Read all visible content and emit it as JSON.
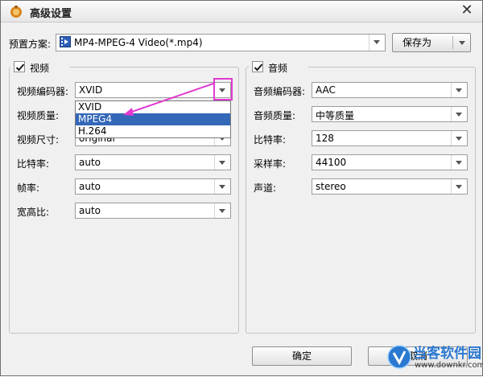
{
  "window": {
    "title": "高级设置",
    "close_glyph": "✕"
  },
  "preset": {
    "label": "预置方案:",
    "value": "MP4-MPEG-4 Video(*.mp4)",
    "save_as_label": "保存为"
  },
  "video": {
    "title": "视频",
    "enabled": true,
    "fields": [
      {
        "label": "视频编码器:",
        "value": "XVID"
      },
      {
        "label": "视频质量:",
        "value": ""
      },
      {
        "label": "视频尺寸:",
        "value": "original"
      },
      {
        "label": "比特率:",
        "value": "auto"
      },
      {
        "label": "帧率:",
        "value": "auto"
      },
      {
        "label": "宽高比:",
        "value": "auto"
      }
    ],
    "encoder_options": [
      "XVID",
      "MPEG4",
      "H.264"
    ],
    "encoder_highlighted": "MPEG4"
  },
  "audio": {
    "title": "音频",
    "enabled": true,
    "fields": [
      {
        "label": "音频编码器:",
        "value": "AAC"
      },
      {
        "label": "音频质量:",
        "value": "中等质量"
      },
      {
        "label": "比特率:",
        "value": "128"
      },
      {
        "label": "采样率:",
        "value": "44100"
      },
      {
        "label": "声道:",
        "value": "stereo"
      }
    ]
  },
  "footer": {
    "ok_label": "确定",
    "cancel_label": "取消"
  },
  "watermark": {
    "name": "当客软件园",
    "url": "www.downkr.com"
  },
  "colors": {
    "annotation": "#e03ad0",
    "selection": "#3367b8",
    "watermark": "#2b78d0"
  }
}
